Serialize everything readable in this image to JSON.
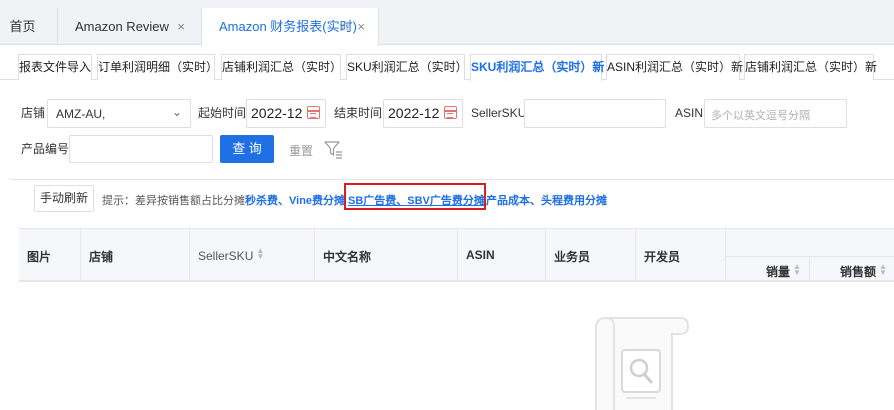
{
  "top_tabs": {
    "home": "首页",
    "review": "Amazon Review",
    "active": "Amazon 财务报表(实时)",
    "close_glyph": "×",
    "star_glyph": "☆"
  },
  "sub_tabs": [
    {
      "label": "报表文件导入",
      "active": false
    },
    {
      "label": "订单利润明细（实时）",
      "active": false
    },
    {
      "label": "店铺利润汇总（实时）",
      "active": false
    },
    {
      "label": "SKU利润汇总（实时）",
      "active": false
    },
    {
      "label": "SKU利润汇总（实时）新",
      "active": true
    },
    {
      "label": "ASIN利润汇总（实时）新",
      "active": false
    },
    {
      "label": "店铺利润汇总（实时）新",
      "active": false
    }
  ],
  "filters": {
    "store_label": "店铺",
    "store_value": "AMZ-AU,",
    "start_label": "起始时间",
    "start_value": "2022-12",
    "end_label": "结束时间",
    "end_value": "2022-12",
    "seller_sku_label": "SellerSKU",
    "seller_sku_value": "",
    "asin_label": "ASIN",
    "asin_placeholder": "多个以英文逗号分隔",
    "product_code_label": "产品编号",
    "product_code_value": "",
    "query_button": "查 询",
    "reset_button": "重置"
  },
  "toolbar": {
    "refresh_button": "手动刷新",
    "hint_prefix": "提示：差异按销售额占比分摊",
    "hint_link_1": "秒杀费、Vine费分摊",
    "hint_link_highlighted": "SB广告费、SBV广告费分摊",
    "hint_link_3": "产品成本、头程费用分摊"
  },
  "table": {
    "columns": [
      "图片",
      "店铺",
      "SellerSKU",
      "中文名称",
      "ASIN",
      "业务员",
      "开发员"
    ],
    "sub_columns": [
      "销量",
      "销售额"
    ]
  },
  "colors": {
    "accent": "#1f6fe5",
    "highlight_border": "#d62020"
  },
  "icons": {
    "calendar": "calendar-icon",
    "filter": "filter-icon",
    "chevron": "chevron-down-icon",
    "empty": "empty-document-search-icon"
  }
}
